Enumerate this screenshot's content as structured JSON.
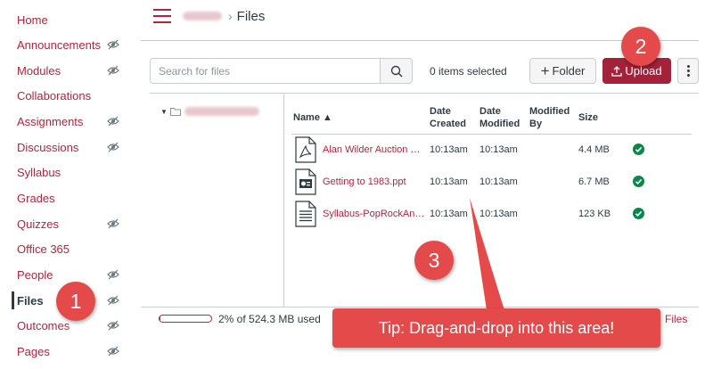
{
  "nav": {
    "items": [
      {
        "label": "Home",
        "hidden": false,
        "active": false
      },
      {
        "label": "Announcements",
        "hidden": true,
        "active": false
      },
      {
        "label": "Modules",
        "hidden": true,
        "active": false
      },
      {
        "label": "Collaborations",
        "hidden": false,
        "active": false
      },
      {
        "label": "Assignments",
        "hidden": true,
        "active": false
      },
      {
        "label": "Discussions",
        "hidden": true,
        "active": false
      },
      {
        "label": "Syllabus",
        "hidden": false,
        "active": false
      },
      {
        "label": "Grades",
        "hidden": false,
        "active": false
      },
      {
        "label": "Quizzes",
        "hidden": true,
        "active": false
      },
      {
        "label": "Office 365",
        "hidden": false,
        "active": false
      },
      {
        "label": "People",
        "hidden": true,
        "active": false
      },
      {
        "label": "Files",
        "hidden": true,
        "active": true
      },
      {
        "label": "Outcomes",
        "hidden": true,
        "active": false
      },
      {
        "label": "Pages",
        "hidden": true,
        "active": false
      }
    ],
    "hidden_icon": "eye-slash-icon"
  },
  "header": {
    "menu_icon": "hamburger-icon",
    "breadcrumb_separator": "›",
    "breadcrumb_current": "Files"
  },
  "toolbar": {
    "search_placeholder": "Search for files",
    "search_icon": "search-icon",
    "items_selected": "0 items selected",
    "folder_label": "Folder",
    "upload_label": "Upload",
    "more_icon": "kebab-menu-icon"
  },
  "tree": {
    "caret": "▼",
    "folder_icon": "folder-icon"
  },
  "table": {
    "columns": {
      "name": "Name ▲",
      "date_created_line1": "Date",
      "date_created_line2": "Created",
      "date_modified_line1": "Date",
      "date_modified_line2": "Modified",
      "modified_by_line1": "Modified",
      "modified_by_line2": "By",
      "size": "Size"
    },
    "rows": [
      {
        "icon": "pdf-file-icon",
        "name": "Alan Wilder Auction Eq...",
        "created": "10:13am",
        "modified": "10:13am",
        "modified_by": "",
        "size": "4.4 MB",
        "status": "published-check-icon"
      },
      {
        "icon": "ppt-file-icon",
        "name": "Getting to 1983.ppt",
        "created": "10:13am",
        "modified": "10:13am",
        "modified_by": "",
        "size": "6.7 MB",
        "status": "published-check-icon"
      },
      {
        "icon": "doc-file-icon",
        "name": "Syllabus-PopRockAndR...",
        "created": "10:13am",
        "modified": "10:13am",
        "modified_by": "",
        "size": "123 KB",
        "status": "published-check-icon"
      }
    ]
  },
  "footer": {
    "quota_fraction": 0.02,
    "quota_text": "2% of 524.3 MB used",
    "files_link": "Files"
  },
  "annotations": {
    "badge_1": "1",
    "badge_2": "2",
    "badge_3": "3",
    "tip": "Tip: Drag-and-drop into this area!"
  },
  "colors": {
    "brand": "#b5243a",
    "upload_button": "#a3223a",
    "annotation": "#e54a4a",
    "published": "#0b874b"
  }
}
